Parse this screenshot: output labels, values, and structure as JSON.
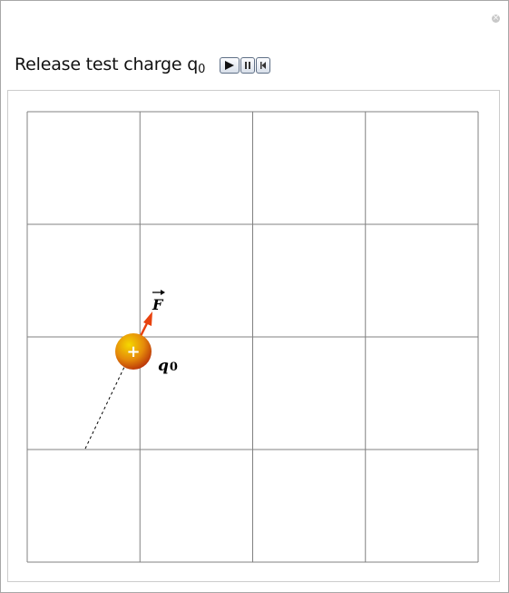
{
  "control": {
    "label_main": "Release test charge q",
    "label_sub": "0",
    "buttons": [
      "play-icon",
      "pause-icon",
      "reset-icon"
    ]
  },
  "corner_icon": "close-icon",
  "plot": {
    "grid_rows": 4,
    "grid_cols": 4,
    "charge_sign": "+",
    "charge_label_main": "q",
    "charge_label_sub": "0",
    "force_label": "F",
    "colors": {
      "grid": "#808080",
      "arrow": "#e8420e",
      "charge_light": "#f5d800",
      "charge_dark": "#b52a0a"
    }
  }
}
